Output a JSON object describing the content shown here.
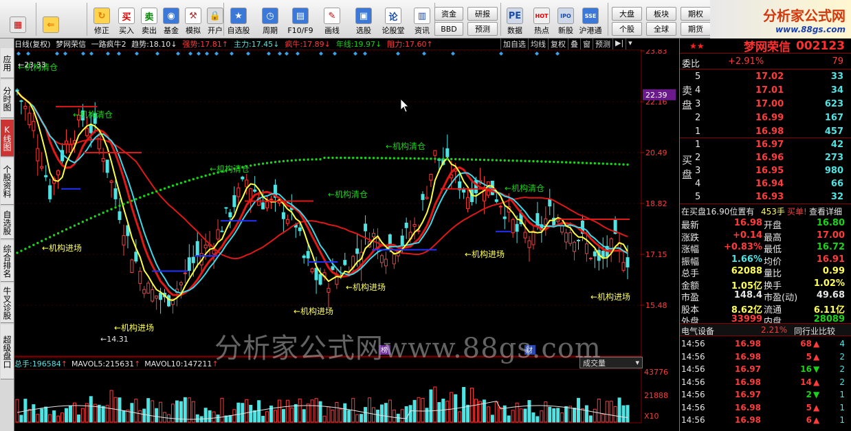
{
  "toolbar": {
    "buttons": [
      {
        "label": "",
        "icon": "grid-icon"
      },
      {
        "label": "",
        "icon": "back-arrow-icon"
      },
      {
        "label": "修正",
        "icon": "refresh-icon"
      },
      {
        "label": "买入",
        "icon": "buy-icon",
        "glyph": "买"
      },
      {
        "label": "卖出",
        "icon": "sell-icon",
        "glyph": "卖"
      },
      {
        "label": "基金",
        "icon": "fund-icon"
      },
      {
        "label": "模拟",
        "icon": "hammer-icon"
      },
      {
        "label": "开户",
        "icon": "lock-icon"
      },
      {
        "label": "自选股",
        "icon": "star-icon"
      },
      {
        "label": "周期",
        "icon": "clock-icon"
      },
      {
        "label": "F10/F9",
        "icon": "f10-icon"
      },
      {
        "label": "画线",
        "icon": "pen-icon"
      },
      {
        "label": "选股",
        "icon": "screen-icon"
      },
      {
        "label": "论股堂",
        "icon": "forum-icon",
        "glyph": "论"
      },
      {
        "label": "资讯",
        "icon": "news-icon"
      },
      {
        "label": "数据",
        "icon": "pe-icon",
        "glyph": "PE"
      },
      {
        "label": "热点",
        "icon": "hot-icon",
        "glyph": "HOT"
      },
      {
        "label": "新股",
        "icon": "ipo-icon",
        "glyph": "IPO"
      },
      {
        "label": "沪港通",
        "icon": "sse-hkex-icon",
        "glyph": "SSE HKE"
      }
    ],
    "small_buttons": [
      "资金",
      "BBD",
      "研报",
      "预测",
      "大盘",
      "板块",
      "期权",
      "个股",
      "全球",
      "期货"
    ]
  },
  "logo": {
    "title": "分析家公式网",
    "url": "www.88gs.com"
  },
  "left_tabs": [
    {
      "label": "应用",
      "active": false
    },
    {
      "label": "分时图",
      "active": false
    },
    {
      "label": "K线图",
      "active": true
    },
    {
      "label": "个股资料",
      "active": false
    },
    {
      "label": "自选股",
      "active": false
    },
    {
      "label": "综合排名",
      "active": false
    },
    {
      "label": "牛叉诊股",
      "active": false
    },
    {
      "label": "超级盘口",
      "active": false
    }
  ],
  "chart_header": {
    "period": "日线(复权)",
    "name": "梦网荣信",
    "indicator": "一路疯牛2",
    "items": [
      {
        "label": "趋势:",
        "value": "18.10",
        "arrow": "↓",
        "color": "#e6e6e6"
      },
      {
        "label": "强势:",
        "value": "17.81",
        "arrow": "↑",
        "color": "#ff3b3b"
      },
      {
        "label": "主力:",
        "value": "17.45",
        "arrow": "↓",
        "color": "#4fe3e3"
      },
      {
        "label": "疯牛:",
        "value": "17.89",
        "arrow": "↓",
        "color": "#ff3b3b"
      },
      {
        "label": "年线:",
        "value": "19.97",
        "arrow": "↓",
        "color": "#19d419"
      },
      {
        "label": "阻力:",
        "value": "17.60",
        "arrow": "↑",
        "color": "#ff3b3b"
      }
    ]
  },
  "chart_tools": [
    "加自选",
    "均线",
    "复权",
    "叠",
    "窗",
    "预测",
    "▶|",
    "▾"
  ],
  "price_axis": {
    "labels": [
      "23.83",
      "22.16",
      "20.49",
      "18.82",
      "17.15",
      "15.48"
    ],
    "highlight": "22.39"
  },
  "annotations": {
    "clear": "机构清仓",
    "enter": "机构进场",
    "high": "23.33",
    "low": "14.31"
  },
  "volume": {
    "header": [
      {
        "label": "总手:",
        "value": "196584",
        "arrow": "↑",
        "color": "#4fe3e3"
      },
      {
        "label": "MAVOL5:",
        "value": "215631",
        "arrow": "↑",
        "color": "#e6e6e6"
      },
      {
        "label": "MAVOL10:",
        "value": "147211",
        "arrow": "↑",
        "color": "#e6e6e6"
      }
    ],
    "combo": "成交量",
    "axis": [
      "43776",
      "21888"
    ],
    "unit": "X10",
    "markers": [
      "榜",
      "财"
    ]
  },
  "watermark": "分析家公式网www.88gs.com",
  "stock": {
    "name": "梦网荣信",
    "code": "002123",
    "wei_bi_label": "委比",
    "wei_bi": "+2.91%",
    "wei_cha": "79",
    "sell_label": "卖盘",
    "buy_label": "买盘",
    "asks": [
      {
        "level": "5",
        "price": "17.02",
        "vol": "33"
      },
      {
        "level": "4",
        "price": "17.01",
        "vol": "34"
      },
      {
        "level": "3",
        "price": "17.00",
        "vol": "623"
      },
      {
        "level": "2",
        "price": "16.99",
        "vol": "167"
      },
      {
        "level": "1",
        "price": "16.98",
        "vol": "457"
      }
    ],
    "bids": [
      {
        "level": "1",
        "price": "16.97",
        "vol": "42"
      },
      {
        "level": "2",
        "price": "16.96",
        "vol": "273"
      },
      {
        "level": "3",
        "price": "16.95",
        "vol": "980"
      },
      {
        "level": "4",
        "price": "16.94",
        "vol": "66"
      },
      {
        "level": "5",
        "price": "16.93",
        "vol": "32"
      }
    ],
    "buy_line": {
      "text": "在买盘16.90位置有",
      "vol": "453手",
      "tag": "买单!",
      "link": "查看详细"
    },
    "quotes": [
      {
        "l1": "最新",
        "v1": "16.98",
        "c1": "red",
        "l2": "开盘",
        "v2": "16.80",
        "c2": "green"
      },
      {
        "l1": "涨跌",
        "v1": "+0.14",
        "c1": "red",
        "l2": "最高",
        "v2": "17.00",
        "c2": "red"
      },
      {
        "l1": "涨幅",
        "v1": "+0.83%",
        "c1": "red",
        "l2": "最低",
        "v2": "16.72",
        "c2": "green"
      },
      {
        "l1": "振幅",
        "v1": "1.66%",
        "c1": "cyan",
        "l2": "均价",
        "v2": "16.91",
        "c2": "red"
      },
      {
        "l1": "总手",
        "v1": "62088",
        "c1": "yellow",
        "l2": "量比",
        "v2": "0.99",
        "c2": "yellow"
      },
      {
        "l1": "金额",
        "v1": "1.05亿",
        "c1": "yellow",
        "l2": "换手",
        "v2": "1.02%",
        "c2": "yellow"
      },
      {
        "l1": "市盈",
        "v1": "148.4",
        "c1": "white",
        "l2": "市盈(动)",
        "v2": "49.68",
        "c2": "white"
      },
      {
        "l1": "股本",
        "v1": "8.62亿",
        "c1": "yellow",
        "l2": "流通",
        "v2": "6.11亿",
        "c2": "yellow"
      },
      {
        "l1": "外盘",
        "v1": "33999",
        "c1": "red",
        "l2": "内盘",
        "v2": "28089",
        "c2": "green"
      }
    ],
    "sector": {
      "name": "电气设备",
      "change": "2.21%",
      "compare": "同行业比较"
    },
    "ticks": [
      {
        "time": "14:56",
        "price": "16.98",
        "vol": "68",
        "dir": "up",
        "n": "4"
      },
      {
        "time": "14:56",
        "price": "16.98",
        "vol": "5",
        "dir": "up",
        "n": "2"
      },
      {
        "time": "14:56",
        "price": "16.97",
        "vol": "16",
        "dir": "down",
        "n": "2"
      },
      {
        "time": "14:56",
        "price": "16.98",
        "vol": "14",
        "dir": "up",
        "n": "2"
      },
      {
        "time": "14:56",
        "price": "16.97",
        "vol": "2",
        "dir": "down",
        "n": "1"
      },
      {
        "time": "14:56",
        "price": "16.98",
        "vol": "5",
        "dir": "up",
        "n": "1"
      },
      {
        "time": "14:56",
        "price": "16.98",
        "vol": "6",
        "dir": "up",
        "n": "1"
      }
    ]
  },
  "colors": {
    "up": "#ff3b3b",
    "down": "#4fe3e3",
    "ma_yellow": "#ffff40",
    "ma_cyan": "#40d8e8",
    "ma_red": "#e01818",
    "year_line": "#19d419"
  }
}
